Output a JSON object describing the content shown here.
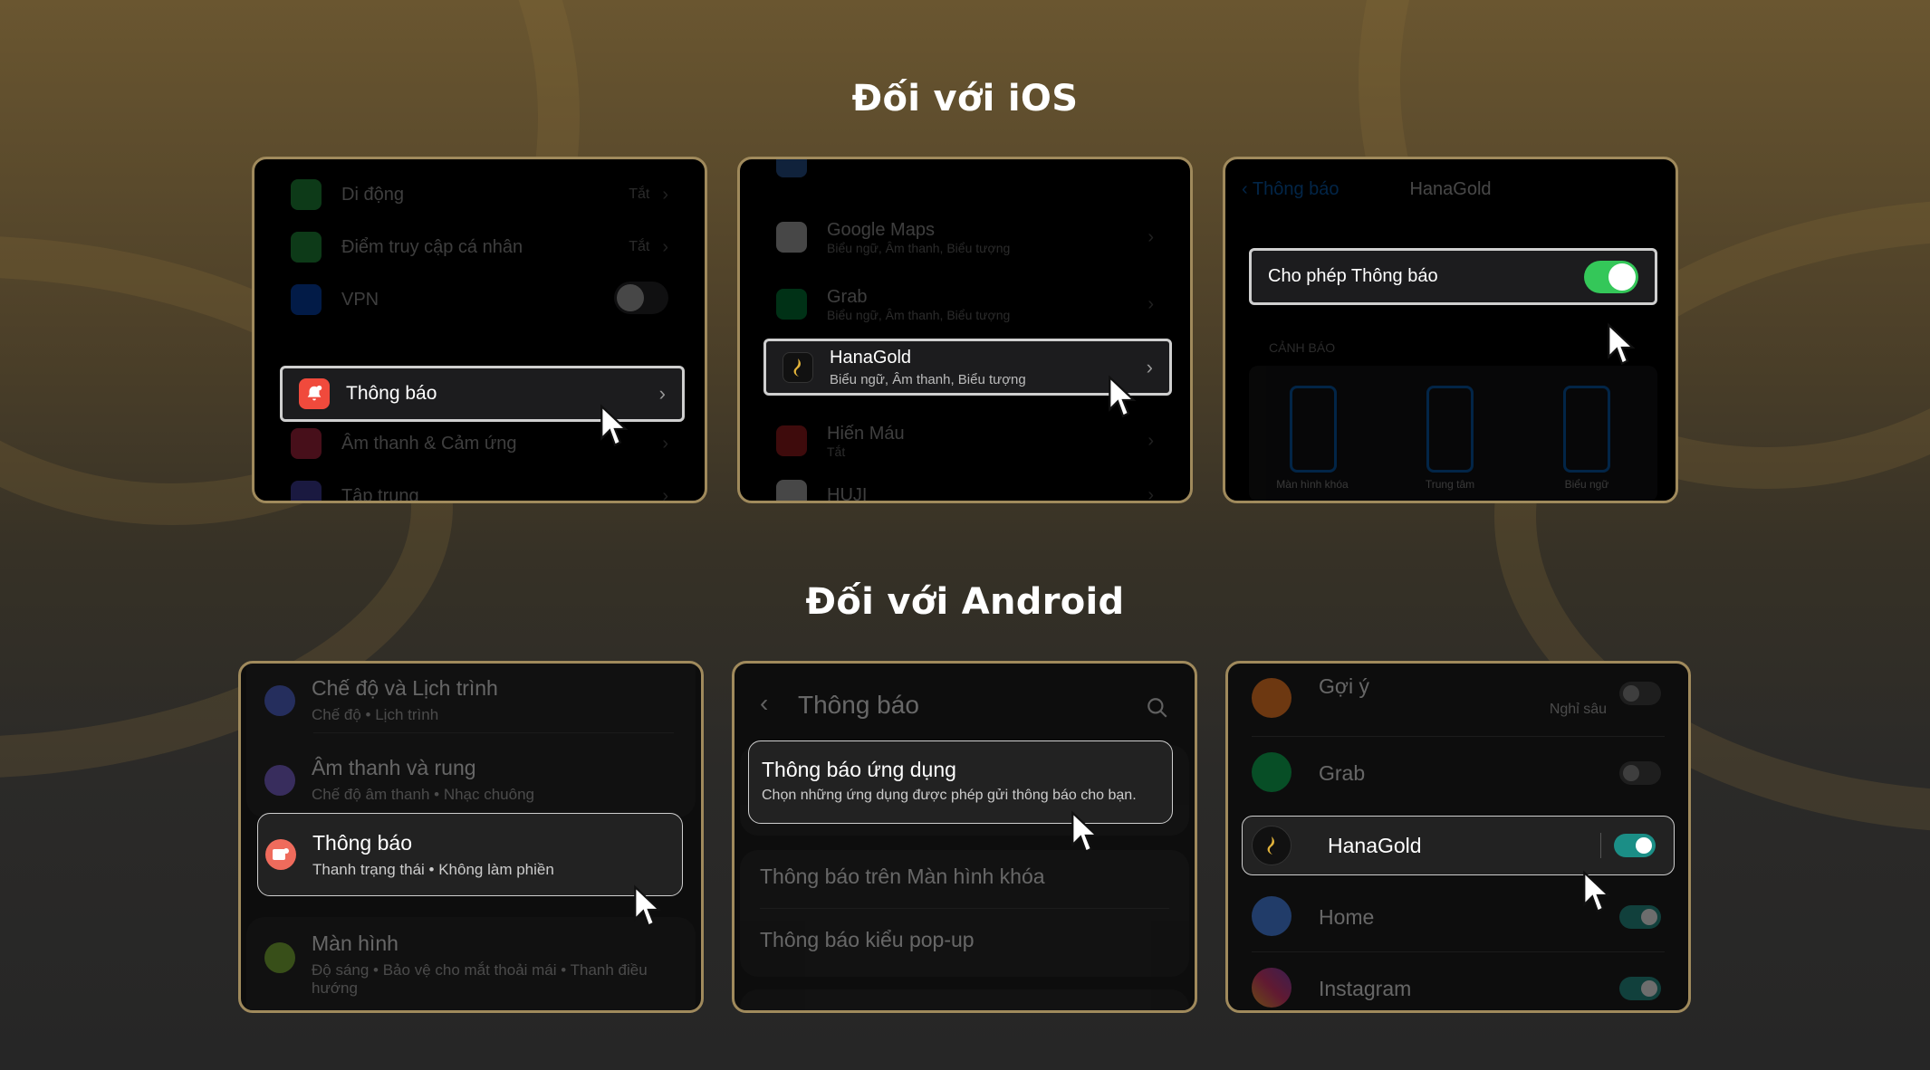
{
  "ios_section": {
    "title": "Đối với iOS",
    "screen1": {
      "rows": [
        {
          "label": "Di động",
          "value": "Tắt"
        },
        {
          "label": "Điểm truy cập cá nhân",
          "value": "Tắt"
        },
        {
          "label": "VPN"
        },
        {
          "label": "Âm thanh & Cảm ứng"
        },
        {
          "label": "Tập trung"
        }
      ],
      "highlight_label": "Thông báo"
    },
    "screen2": {
      "rows": [
        {
          "label": "Google Maps",
          "sub": "Biểu ngữ, Âm thanh, Biểu tượng"
        },
        {
          "label": "Grab",
          "sub": "Biểu ngữ, Âm thanh, Biểu tượng"
        },
        {
          "label": "Hiến Máu",
          "sub": "Tắt"
        },
        {
          "label": "HUJI"
        }
      ],
      "highlight_label": "HanaGold",
      "highlight_sub": "Biểu ngữ, Âm thanh, Biểu tượng"
    },
    "screen3": {
      "back_label": "Thông báo",
      "header_title": "HanaGold",
      "highlight_label": "Cho phép Thông báo",
      "toggle_on": true,
      "section_label": "CẢNH BÁO",
      "alert_styles": [
        "Màn hình khóa",
        "Trung tâm",
        "Biểu ngữ"
      ]
    }
  },
  "android_section": {
    "title": "Đối với Android",
    "screen1": {
      "item1": {
        "title": "Chế độ và Lịch trình",
        "sub": "Chế độ • Lịch trình"
      },
      "item2": {
        "title": "Âm thanh và rung",
        "sub": "Chế độ âm thanh • Nhạc chuông"
      },
      "highlight": {
        "title": "Thông báo",
        "sub": "Thanh trạng thái • Không làm phiền"
      },
      "item4": {
        "title": "Màn hình",
        "sub": "Độ sáng • Bảo vệ cho mắt thoải mái • Thanh điều hướng"
      }
    },
    "screen2": {
      "header_title": "Thông báo",
      "highlight": {
        "title": "Thông báo ứng dụng",
        "sub": "Chọn những ứng dụng được phép gửi thông báo cho bạn."
      },
      "item2": "Thông báo trên Màn hình khóa",
      "item3": "Thông báo kiểu pop-up"
    },
    "screen3": {
      "apps": [
        {
          "name": "Gợi ý",
          "sub": "Nghỉ sâu",
          "on": false
        },
        {
          "name": "Grab",
          "on": false
        },
        {
          "name": "Home",
          "on": true
        },
        {
          "name": "Instagram",
          "on": true
        }
      ],
      "highlight": {
        "name": "HanaGold",
        "on": true
      }
    }
  },
  "colors": {
    "card_border": "#a08a5c",
    "ios_toggle_on": "#34c759",
    "android_toggle_on": "#1b8e86",
    "notif_icon": "#f04a3c"
  }
}
